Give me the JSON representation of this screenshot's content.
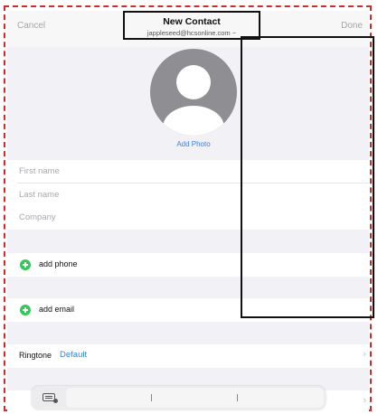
{
  "nav": {
    "cancel": "Cancel",
    "title": "New Contact",
    "subtitle": "jappleseed@hcsonline.com ~",
    "done": "Done"
  },
  "photo": {
    "add_label": "Add Photo"
  },
  "fields": {
    "first_name": "First name",
    "last_name": "Last name",
    "company": "Company"
  },
  "actions": {
    "add_phone": "add phone",
    "add_email": "add email"
  },
  "ringtone": {
    "label": "Ringtone",
    "value": "Default"
  },
  "icons": {
    "add": "plus-circle-icon",
    "chevron": "chevron-right-icon",
    "keyboard": "keyboard-icon",
    "avatar": "person-silhouette-icon"
  },
  "colors": {
    "accent": "#3a82e0",
    "add_green": "#34c759",
    "annotation_dashed": "#d02a2a"
  }
}
